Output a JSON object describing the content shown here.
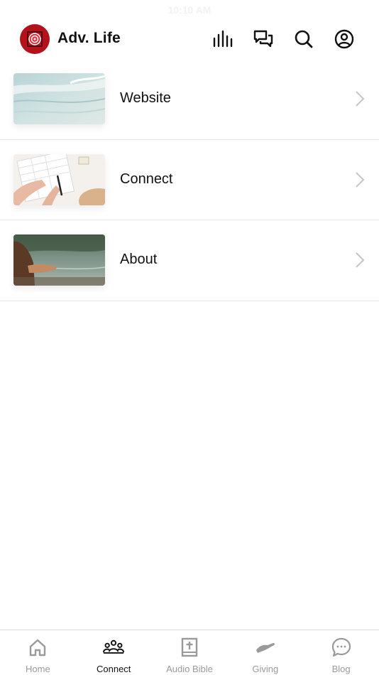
{
  "status": {
    "time": "10:10 AM"
  },
  "header": {
    "title": "Adv. Life",
    "icons": [
      "bar-chart-icon",
      "chat-bubbles-icon",
      "search-icon",
      "profile-icon"
    ]
  },
  "list": {
    "items": [
      {
        "label": "Website",
        "thumbnail": "ocean-water-image"
      },
      {
        "label": "Connect",
        "thumbnail": "notebook-writing-image"
      },
      {
        "label": "About",
        "thumbnail": "lake-hands-image"
      }
    ]
  },
  "tabs": [
    {
      "label": "Home",
      "icon": "home-icon",
      "active": false
    },
    {
      "label": "Connect",
      "icon": "group-icon",
      "active": true
    },
    {
      "label": "Audio Bible",
      "icon": "bible-icon",
      "active": false
    },
    {
      "label": "Giving",
      "icon": "giving-hand-icon",
      "active": false
    },
    {
      "label": "Blog",
      "icon": "chat-bubble-icon",
      "active": false
    }
  ],
  "colors": {
    "brand": "#b3121b",
    "active_tab": "#111111",
    "inactive_tab": "#9a9a9a",
    "divider": "#e6e6e6"
  }
}
